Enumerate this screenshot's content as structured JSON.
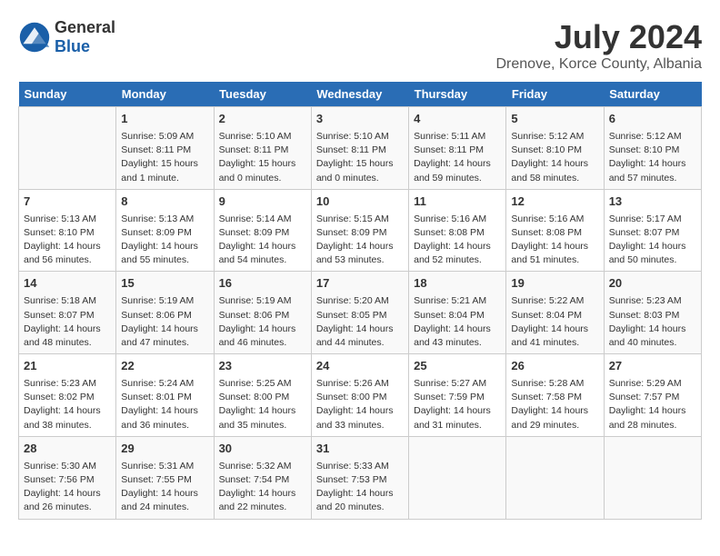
{
  "header": {
    "logo_general": "General",
    "logo_blue": "Blue",
    "month_title": "July 2024",
    "location": "Drenove, Korce County, Albania"
  },
  "weekdays": [
    "Sunday",
    "Monday",
    "Tuesday",
    "Wednesday",
    "Thursday",
    "Friday",
    "Saturday"
  ],
  "weeks": [
    [
      {
        "day": "",
        "info": ""
      },
      {
        "day": "1",
        "info": "Sunrise: 5:09 AM\nSunset: 8:11 PM\nDaylight: 15 hours\nand 1 minute."
      },
      {
        "day": "2",
        "info": "Sunrise: 5:10 AM\nSunset: 8:11 PM\nDaylight: 15 hours\nand 0 minutes."
      },
      {
        "day": "3",
        "info": "Sunrise: 5:10 AM\nSunset: 8:11 PM\nDaylight: 15 hours\nand 0 minutes."
      },
      {
        "day": "4",
        "info": "Sunrise: 5:11 AM\nSunset: 8:11 PM\nDaylight: 14 hours\nand 59 minutes."
      },
      {
        "day": "5",
        "info": "Sunrise: 5:12 AM\nSunset: 8:10 PM\nDaylight: 14 hours\nand 58 minutes."
      },
      {
        "day": "6",
        "info": "Sunrise: 5:12 AM\nSunset: 8:10 PM\nDaylight: 14 hours\nand 57 minutes."
      }
    ],
    [
      {
        "day": "7",
        "info": "Sunrise: 5:13 AM\nSunset: 8:10 PM\nDaylight: 14 hours\nand 56 minutes."
      },
      {
        "day": "8",
        "info": "Sunrise: 5:13 AM\nSunset: 8:09 PM\nDaylight: 14 hours\nand 55 minutes."
      },
      {
        "day": "9",
        "info": "Sunrise: 5:14 AM\nSunset: 8:09 PM\nDaylight: 14 hours\nand 54 minutes."
      },
      {
        "day": "10",
        "info": "Sunrise: 5:15 AM\nSunset: 8:09 PM\nDaylight: 14 hours\nand 53 minutes."
      },
      {
        "day": "11",
        "info": "Sunrise: 5:16 AM\nSunset: 8:08 PM\nDaylight: 14 hours\nand 52 minutes."
      },
      {
        "day": "12",
        "info": "Sunrise: 5:16 AM\nSunset: 8:08 PM\nDaylight: 14 hours\nand 51 minutes."
      },
      {
        "day": "13",
        "info": "Sunrise: 5:17 AM\nSunset: 8:07 PM\nDaylight: 14 hours\nand 50 minutes."
      }
    ],
    [
      {
        "day": "14",
        "info": "Sunrise: 5:18 AM\nSunset: 8:07 PM\nDaylight: 14 hours\nand 48 minutes."
      },
      {
        "day": "15",
        "info": "Sunrise: 5:19 AM\nSunset: 8:06 PM\nDaylight: 14 hours\nand 47 minutes."
      },
      {
        "day": "16",
        "info": "Sunrise: 5:19 AM\nSunset: 8:06 PM\nDaylight: 14 hours\nand 46 minutes."
      },
      {
        "day": "17",
        "info": "Sunrise: 5:20 AM\nSunset: 8:05 PM\nDaylight: 14 hours\nand 44 minutes."
      },
      {
        "day": "18",
        "info": "Sunrise: 5:21 AM\nSunset: 8:04 PM\nDaylight: 14 hours\nand 43 minutes."
      },
      {
        "day": "19",
        "info": "Sunrise: 5:22 AM\nSunset: 8:04 PM\nDaylight: 14 hours\nand 41 minutes."
      },
      {
        "day": "20",
        "info": "Sunrise: 5:23 AM\nSunset: 8:03 PM\nDaylight: 14 hours\nand 40 minutes."
      }
    ],
    [
      {
        "day": "21",
        "info": "Sunrise: 5:23 AM\nSunset: 8:02 PM\nDaylight: 14 hours\nand 38 minutes."
      },
      {
        "day": "22",
        "info": "Sunrise: 5:24 AM\nSunset: 8:01 PM\nDaylight: 14 hours\nand 36 minutes."
      },
      {
        "day": "23",
        "info": "Sunrise: 5:25 AM\nSunset: 8:00 PM\nDaylight: 14 hours\nand 35 minutes."
      },
      {
        "day": "24",
        "info": "Sunrise: 5:26 AM\nSunset: 8:00 PM\nDaylight: 14 hours\nand 33 minutes."
      },
      {
        "day": "25",
        "info": "Sunrise: 5:27 AM\nSunset: 7:59 PM\nDaylight: 14 hours\nand 31 minutes."
      },
      {
        "day": "26",
        "info": "Sunrise: 5:28 AM\nSunset: 7:58 PM\nDaylight: 14 hours\nand 29 minutes."
      },
      {
        "day": "27",
        "info": "Sunrise: 5:29 AM\nSunset: 7:57 PM\nDaylight: 14 hours\nand 28 minutes."
      }
    ],
    [
      {
        "day": "28",
        "info": "Sunrise: 5:30 AM\nSunset: 7:56 PM\nDaylight: 14 hours\nand 26 minutes."
      },
      {
        "day": "29",
        "info": "Sunrise: 5:31 AM\nSunset: 7:55 PM\nDaylight: 14 hours\nand 24 minutes."
      },
      {
        "day": "30",
        "info": "Sunrise: 5:32 AM\nSunset: 7:54 PM\nDaylight: 14 hours\nand 22 minutes."
      },
      {
        "day": "31",
        "info": "Sunrise: 5:33 AM\nSunset: 7:53 PM\nDaylight: 14 hours\nand 20 minutes."
      },
      {
        "day": "",
        "info": ""
      },
      {
        "day": "",
        "info": ""
      },
      {
        "day": "",
        "info": ""
      }
    ]
  ]
}
